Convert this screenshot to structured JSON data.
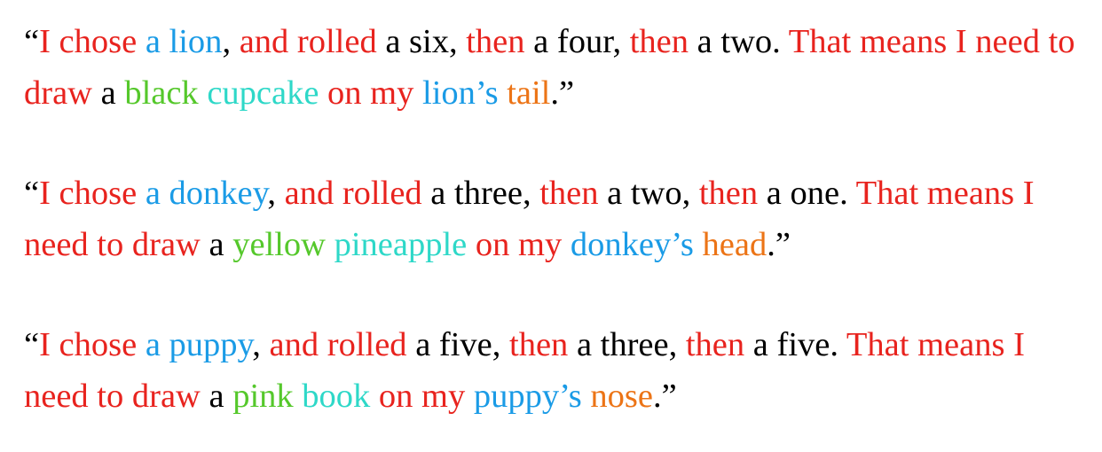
{
  "colors": {
    "red": "#e8231e",
    "blue": "#1a9be6",
    "black": "#000000",
    "green": "#55c82b",
    "teal": "#2ed8c8",
    "orange": "#ec7416"
  },
  "paragraphs": [
    {
      "segments": [
        {
          "text": "“",
          "color": "black"
        },
        {
          "text": "I chose ",
          "color": "red"
        },
        {
          "text": "a lion",
          "color": "blue"
        },
        {
          "text": ", ",
          "color": "black"
        },
        {
          "text": "and rolled",
          "color": "red"
        },
        {
          "text": " a six, ",
          "color": "black"
        },
        {
          "text": "then",
          "color": "red"
        },
        {
          "text": " a four, ",
          "color": "black"
        },
        {
          "text": "then",
          "color": "red"
        },
        {
          "text": " a two. ",
          "color": "black"
        },
        {
          "text": "That means I need to draw",
          "color": "red"
        },
        {
          "text": " a ",
          "color": "black"
        },
        {
          "text": "black",
          "color": "green"
        },
        {
          "text": " ",
          "color": "black"
        },
        {
          "text": "cupcake",
          "color": "teal"
        },
        {
          "text": " on my ",
          "color": "red"
        },
        {
          "text": "lion’s",
          "color": "blue"
        },
        {
          "text": " ",
          "color": "black"
        },
        {
          "text": "tail",
          "color": "orange"
        },
        {
          "text": ".”",
          "color": "black"
        }
      ]
    },
    {
      "segments": [
        {
          "text": "“",
          "color": "black"
        },
        {
          "text": "I chose ",
          "color": "red"
        },
        {
          "text": "a donkey",
          "color": "blue"
        },
        {
          "text": ", ",
          "color": "black"
        },
        {
          "text": "and rolled",
          "color": "red"
        },
        {
          "text": " a three, ",
          "color": "black"
        },
        {
          "text": "then",
          "color": "red"
        },
        {
          "text": " a two, ",
          "color": "black"
        },
        {
          "text": "then",
          "color": "red"
        },
        {
          "text": " a one. ",
          "color": "black"
        },
        {
          "text": "That means I need to draw",
          "color": "red"
        },
        {
          "text": " a ",
          "color": "black"
        },
        {
          "text": "yellow",
          "color": "green"
        },
        {
          "text": " ",
          "color": "black"
        },
        {
          "text": "pineapple",
          "color": "teal"
        },
        {
          "text": " on my ",
          "color": "red"
        },
        {
          "text": "donkey’s",
          "color": "blue"
        },
        {
          "text": " ",
          "color": "black"
        },
        {
          "text": "head",
          "color": "orange"
        },
        {
          "text": ".”",
          "color": "black"
        }
      ]
    },
    {
      "segments": [
        {
          "text": "“",
          "color": "black"
        },
        {
          "text": "I chose ",
          "color": "red"
        },
        {
          "text": "a puppy",
          "color": "blue"
        },
        {
          "text": ", ",
          "color": "black"
        },
        {
          "text": "and rolled",
          "color": "red"
        },
        {
          "text": " a five, ",
          "color": "black"
        },
        {
          "text": "then",
          "color": "red"
        },
        {
          "text": " a three, ",
          "color": "black"
        },
        {
          "text": "then",
          "color": "red"
        },
        {
          "text": " a five. ",
          "color": "black"
        },
        {
          "text": "That means I need to draw",
          "color": "red"
        },
        {
          "text": " a ",
          "color": "black"
        },
        {
          "text": "pink",
          "color": "green"
        },
        {
          "text": " ",
          "color": "black"
        },
        {
          "text": "book",
          "color": "teal"
        },
        {
          "text": " on my ",
          "color": "red"
        },
        {
          "text": "puppy’s",
          "color": "blue"
        },
        {
          "text": " ",
          "color": "black"
        },
        {
          "text": "nose",
          "color": "orange"
        },
        {
          "text": ".”",
          "color": "black"
        }
      ]
    }
  ]
}
